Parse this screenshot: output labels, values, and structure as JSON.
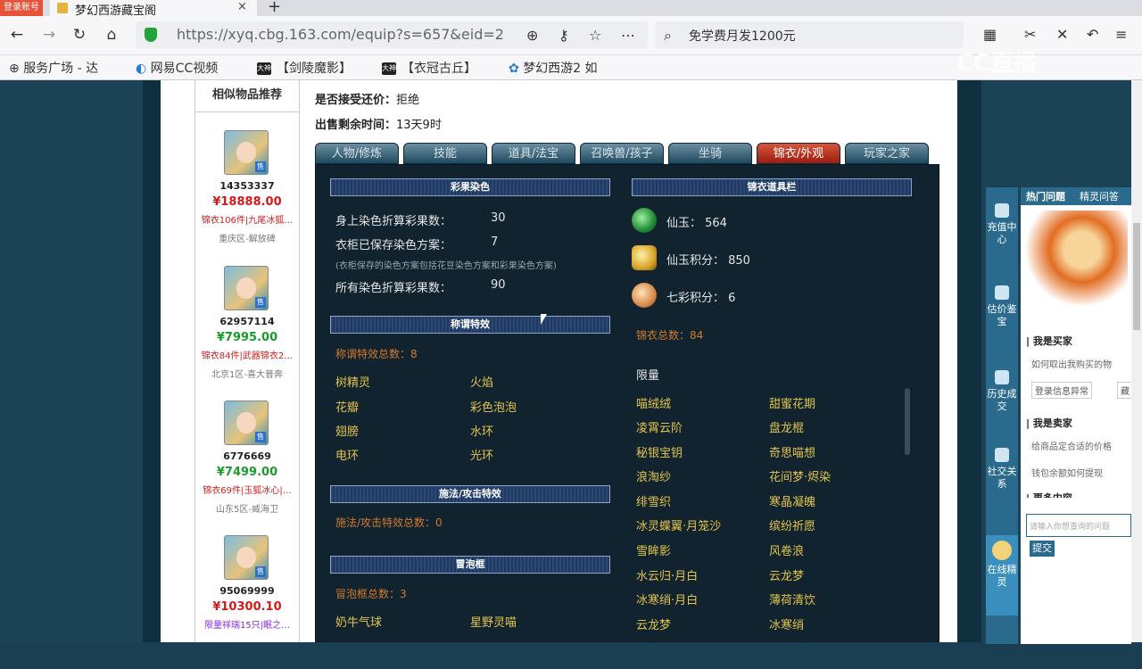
{
  "browser": {
    "login_badge": "登录账号",
    "tab_title": "梦幻西游藏宝阁",
    "tab_close": "×",
    "new_tab": "+",
    "url": "https://xyq.cbg.163.com/equip?s=657&eid=2",
    "search_text": "免学费月发1200元",
    "bookmarks": [
      "服务广场 - 达",
      "网易CC视频",
      "【剑陵魔影】",
      "【衣冠古丘】",
      "梦幻西游2 如"
    ],
    "overlay_logo": "CC直播"
  },
  "sidebar": {
    "title": "相似物品推荐",
    "items": [
      {
        "id": "14353337",
        "price": "¥18888.00",
        "price_color": "#d11b1b",
        "desc": "锦衣106件|九尾冰狐…",
        "desc_color": "#d11b1b",
        "server": "重庆区-解放碑"
      },
      {
        "id": "62957114",
        "price": "¥7995.00",
        "price_color": "#1a9b2c",
        "desc": "锦衣84件|武器锦衣2…",
        "desc_color": "#d11b1b",
        "server": "北京1区-喜大普奔"
      },
      {
        "id": "6776669",
        "price": "¥7499.00",
        "price_color": "#1a9b2c",
        "desc": "锦衣69件|玉狐冰心|…",
        "desc_color": "#d11b1b",
        "server": "山东5区-威海卫"
      },
      {
        "id": "95069999",
        "price": "¥10300.10",
        "price_color": "#d11b1b",
        "desc": "限量祥瑞15只|眠之…",
        "desc_color": "#8a2bd6",
        "server": ""
      }
    ]
  },
  "info": {
    "bargain_label": "是否接受还价：",
    "bargain_value": "拒绝",
    "time_label": "出售剩余时间：",
    "time_value": "13天9时"
  },
  "tabs": [
    "人物/修炼",
    "技能",
    "道具/法宝",
    "召唤兽/孩子",
    "坐骑",
    "锦衣/外观",
    "玩家之家"
  ],
  "panel": {
    "dye_section": "彩果染色",
    "dye_rows": [
      {
        "label": "身上染色折算彩果数：",
        "value": "30"
      },
      {
        "label": "衣柜已保存染色方案：",
        "value": "7"
      },
      {
        "label": "所有染色折算彩果数：",
        "value": "90"
      }
    ],
    "dye_note": "(衣柜保存的染色方案包括花豆染色方案和彩果染色方案)",
    "title_section": "称谓特效",
    "title_total": "称谓特效总数：8",
    "title_items": [
      "树精灵",
      "火焰",
      "花瓣",
      "彩色泡泡",
      "翅膀",
      "水环",
      "电环",
      "光环"
    ],
    "spell_section": "施法/攻击特效",
    "spell_total": "施法/攻击特效总数：0",
    "bubble_section": "冒泡框",
    "bubble_total": "冒泡框总数：3",
    "bubble_items": [
      "奶牛气球",
      "星野灵喵"
    ],
    "jinyi_section": "锦衣道具栏",
    "currencies": [
      {
        "label": "仙玉： 564",
        "icon": "jade-coin-icon"
      },
      {
        "label": "仙玉积分： 850",
        "icon": "jade-points-icon"
      },
      {
        "label": "七彩积分： 6",
        "icon": "rainbow-points-icon"
      }
    ],
    "jinyi_total": "锦衣总数：84",
    "limited_label": "限量",
    "limited_items": [
      "喵绒绒",
      "甜蜜花期",
      "凌霄云阶",
      "盘龙棍",
      "秘银宝钥",
      "奇思喵想",
      "浪淘纱",
      "花间梦·烬染",
      "绯雪织",
      "寒晶凝魄",
      "冰灵蝶翼·月笼沙",
      "缤纷祈愿",
      "雪眸影",
      "风卷浪",
      "水云归·月白",
      "云龙梦",
      "冰寒绡·月白",
      "薄荷清饮",
      "云龙梦",
      "冰寒绡"
    ]
  },
  "rightbar": [
    "充值中心",
    "估价鉴宝",
    "历史成交",
    "社交关系",
    "在线精灵"
  ],
  "help": {
    "tab1": "热门问题",
    "tab2": "精灵问答",
    "buyer_h": "| 我是买家",
    "buyer_q": "如何取出我购买的物",
    "buyer_btn1": "登录信息异常",
    "buyer_btn2": "藏",
    "seller_h": "| 我是卖家",
    "seller_q1": "给商品定合适的价格",
    "seller_q2": "钱包余额如何提现",
    "more_h": "| 更多内容",
    "input_ph": "请输入你想查询的问题",
    "submit": "提交"
  }
}
